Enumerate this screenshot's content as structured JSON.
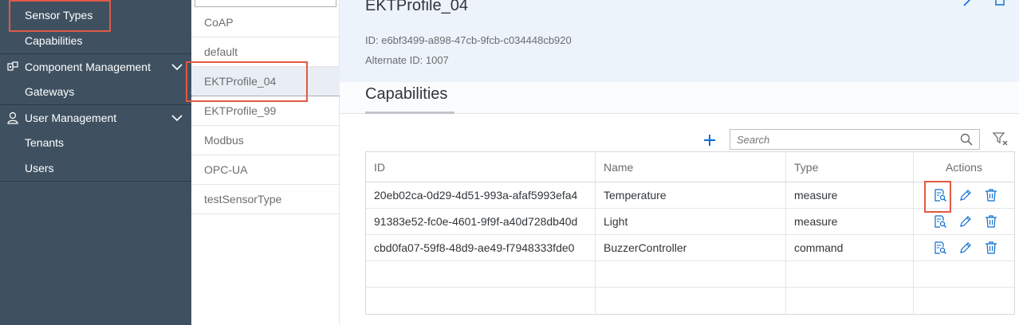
{
  "sidebar": {
    "items": [
      {
        "label": "Sensor Types",
        "kind": "sub",
        "selected": true
      },
      {
        "label": "Capabilities",
        "kind": "sub"
      },
      {
        "label": "Component Management",
        "kind": "group",
        "icon": "component-icon"
      },
      {
        "label": "Gateways",
        "kind": "sub"
      },
      {
        "label": "User Management",
        "kind": "group",
        "icon": "user-icon"
      },
      {
        "label": "Tenants",
        "kind": "sub"
      },
      {
        "label": "Users",
        "kind": "sub"
      }
    ]
  },
  "sensor_types": {
    "items": [
      "CoAP",
      "default",
      "EKTProfile_04",
      "EKTProfile_99",
      "Modbus",
      "OPC-UA",
      "testSensorType"
    ],
    "selected": "EKTProfile_04"
  },
  "detail": {
    "title": "EKTProfile_04",
    "id_line": "ID: e6bf3499-a898-47cb-9fcb-c034448cb920",
    "alt_id_line": "Alternate ID: 1007",
    "tab": "Capabilities",
    "search_placeholder": "Search",
    "table": {
      "headers": {
        "id": "ID",
        "name": "Name",
        "type": "Type",
        "actions": "Actions"
      },
      "rows": [
        {
          "id": "20eb02ca-0d29-4d51-993a-afaf5993efa4",
          "name": "Temperature",
          "type": "measure"
        },
        {
          "id": "91383e52-fc0e-4601-9f9f-a40d728db40d",
          "name": "Light",
          "type": "measure"
        },
        {
          "id": "cbd0fa07-59f8-48d9-ae49-f7948333fde0",
          "name": "BuzzerController",
          "type": "command"
        }
      ]
    }
  },
  "colors": {
    "sidebar_bg": "#3f5161",
    "accent": "#0a6ed1",
    "highlight": "#e05a45",
    "header_bg": "#edf3fa"
  }
}
